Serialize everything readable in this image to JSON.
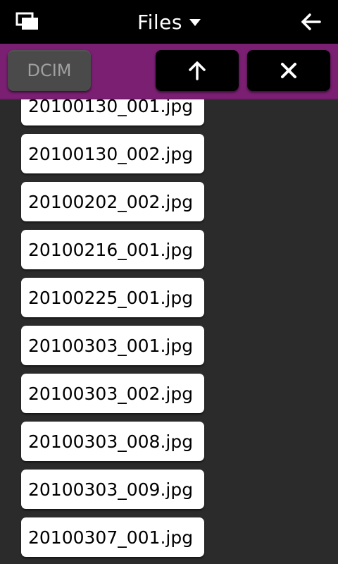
{
  "titlebar": {
    "title": "Files",
    "task_switcher_icon": "task-switcher-icon",
    "menu_icon": "dropdown-caret-icon",
    "back_icon": "back-arrow-icon"
  },
  "toolbar": {
    "folder_label": "DCIM",
    "up_icon": "up-arrow-icon",
    "close_icon": "close-icon",
    "accent_color": "#7a1f72"
  },
  "files": [
    "20100130_001.jpg",
    "20100130_002.jpg",
    "20100202_002.jpg",
    "20100216_001.jpg",
    "20100225_001.jpg",
    "20100303_001.jpg",
    "20100303_002.jpg",
    "20100303_008.jpg",
    "20100303_009.jpg",
    "20100307_001.jpg"
  ]
}
